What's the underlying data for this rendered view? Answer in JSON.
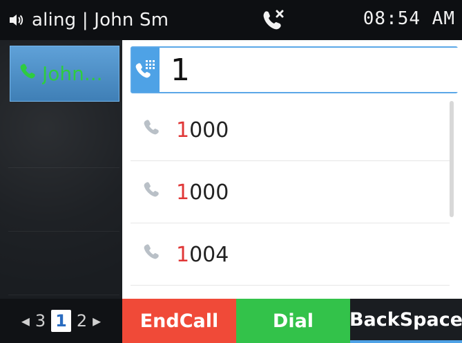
{
  "status_bar": {
    "title": "aling | John Sm",
    "time": "08:54 AM",
    "icons": {
      "left": "speaker-icon",
      "center": "missed-call-icon"
    }
  },
  "call_list": {
    "active_call_name": "John...",
    "icon": "phone-icon"
  },
  "dialer": {
    "input_value": "1",
    "input_placeholder": "",
    "badge_icon": "dialpad-icon",
    "suggestions": [
      {
        "highlight": "1",
        "rest": "000",
        "icon": "phone-icon"
      },
      {
        "highlight": "1",
        "rest": "000",
        "icon": "phone-icon"
      },
      {
        "highlight": "1",
        "rest": "004",
        "icon": "phone-icon"
      }
    ]
  },
  "pager": {
    "prev": "3",
    "current": "1",
    "next": "2"
  },
  "softkeys": {
    "endcall": "EndCall",
    "dial": "Dial",
    "backspace": "BackSpace"
  },
  "colors": {
    "accent_blue": "#4ea2e6",
    "end_call_red": "#f04a38",
    "dial_green": "#33c24a",
    "match_red": "#e03636",
    "caller_green": "#2ecc40"
  }
}
